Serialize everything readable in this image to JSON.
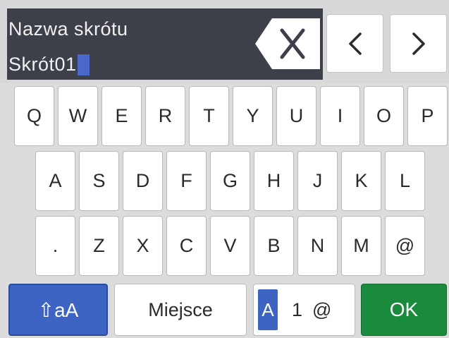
{
  "input": {
    "title": "Nazwa skrótu",
    "value": "Skrót01"
  },
  "nav": {
    "backspace_icon": "backspace-x-icon",
    "left_icon": "chevron-left-icon",
    "right_icon": "chevron-right-icon"
  },
  "keyboard": {
    "rows": [
      [
        "Q",
        "W",
        "E",
        "R",
        "T",
        "Y",
        "U",
        "I",
        "O",
        "P"
      ],
      [
        "A",
        "S",
        "D",
        "F",
        "G",
        "H",
        "J",
        "K",
        "L"
      ],
      [
        ".",
        "Z",
        "X",
        "C",
        "V",
        "B",
        "N",
        "M",
        "@"
      ]
    ]
  },
  "function_keys": {
    "shift_label": "⇧aA",
    "space_label": "Miejsce",
    "mode_a": "A",
    "mode_1": "1",
    "mode_at": "@",
    "ok_label": "OK"
  },
  "colors": {
    "text_area_bg": "#3d4048",
    "cursor": "#4a68c8",
    "shift_bg": "#3d63c3",
    "ok_bg": "#1a8b3c"
  }
}
